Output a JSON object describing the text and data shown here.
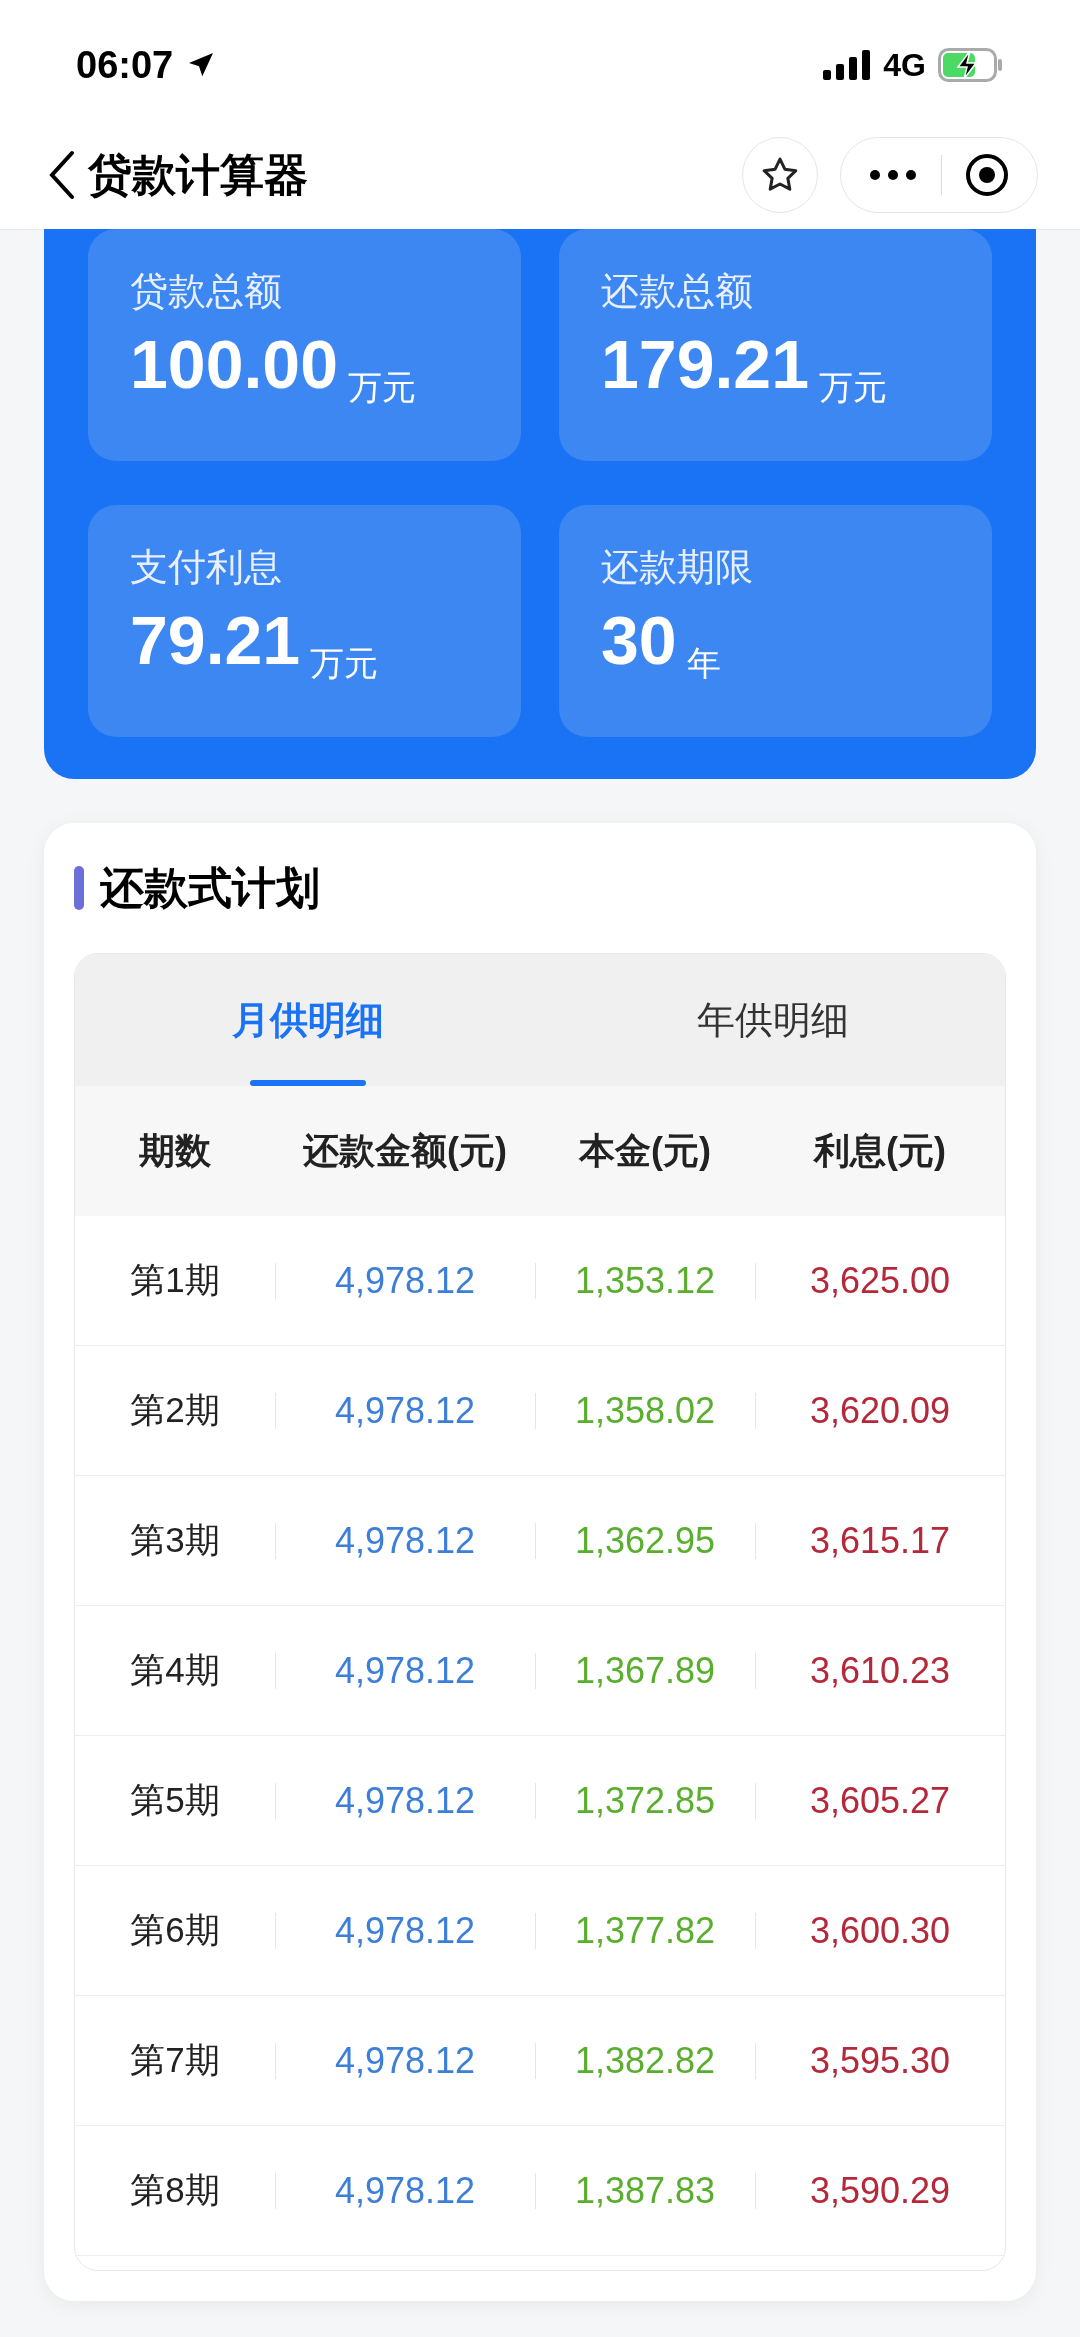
{
  "status_bar": {
    "time": "06:07",
    "network": "4G"
  },
  "nav": {
    "title": "贷款计算器"
  },
  "summary": [
    {
      "label": "贷款总额",
      "value": "100.00",
      "unit": "万元"
    },
    {
      "label": "还款总额",
      "value": "179.21",
      "unit": "万元"
    },
    {
      "label": "支付利息",
      "value": "79.21",
      "unit": "万元"
    },
    {
      "label": "还款期限",
      "value": "30",
      "unit": "年"
    }
  ],
  "plan": {
    "title": "还款式计划",
    "tabs": [
      {
        "label": "月供明细",
        "selected": true
      },
      {
        "label": "年供明细",
        "selected": false
      }
    ],
    "columns": [
      "期数",
      "还款金额(元)",
      "本金(元)",
      "利息(元)"
    ],
    "rows": [
      {
        "period": "第1期",
        "payment": "4,978.12",
        "principal": "1,353.12",
        "interest": "3,625.00"
      },
      {
        "period": "第2期",
        "payment": "4,978.12",
        "principal": "1,358.02",
        "interest": "3,620.09"
      },
      {
        "period": "第3期",
        "payment": "4,978.12",
        "principal": "1,362.95",
        "interest": "3,615.17"
      },
      {
        "period": "第4期",
        "payment": "4,978.12",
        "principal": "1,367.89",
        "interest": "3,610.23"
      },
      {
        "period": "第5期",
        "payment": "4,978.12",
        "principal": "1,372.85",
        "interest": "3,605.27"
      },
      {
        "period": "第6期",
        "payment": "4,978.12",
        "principal": "1,377.82",
        "interest": "3,600.30"
      },
      {
        "period": "第7期",
        "payment": "4,978.12",
        "principal": "1,382.82",
        "interest": "3,595.30"
      },
      {
        "period": "第8期",
        "payment": "4,978.12",
        "principal": "1,387.83",
        "interest": "3,590.29"
      }
    ]
  }
}
